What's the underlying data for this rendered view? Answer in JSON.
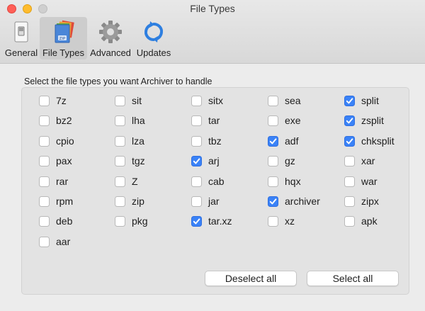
{
  "window": {
    "title": "File Types"
  },
  "toolbar": {
    "items": [
      {
        "label": "General",
        "icon": "switch-icon",
        "active": false
      },
      {
        "label": "File Types",
        "icon": "zip-archive-icon",
        "active": true
      },
      {
        "label": "Advanced",
        "icon": "gear-icon",
        "active": false
      },
      {
        "label": "Updates",
        "icon": "refresh-icon",
        "active": false
      }
    ]
  },
  "instructions": "Select the file types you want Archiver to handle",
  "file_types": {
    "columns": [
      [
        {
          "label": "7z",
          "checked": false
        },
        {
          "label": "bz2",
          "checked": false
        },
        {
          "label": "cpio",
          "checked": false
        },
        {
          "label": "pax",
          "checked": false
        },
        {
          "label": "rar",
          "checked": false
        },
        {
          "label": "rpm",
          "checked": false
        },
        {
          "label": "deb",
          "checked": false
        },
        {
          "label": "aar",
          "checked": false
        }
      ],
      [
        {
          "label": "sit",
          "checked": false
        },
        {
          "label": "lha",
          "checked": false
        },
        {
          "label": "lza",
          "checked": false
        },
        {
          "label": "tgz",
          "checked": false
        },
        {
          "label": "Z",
          "checked": false
        },
        {
          "label": "zip",
          "checked": false
        },
        {
          "label": "pkg",
          "checked": false
        }
      ],
      [
        {
          "label": "sitx",
          "checked": false
        },
        {
          "label": "tar",
          "checked": false
        },
        {
          "label": "tbz",
          "checked": false
        },
        {
          "label": "arj",
          "checked": true
        },
        {
          "label": "cab",
          "checked": false
        },
        {
          "label": "jar",
          "checked": false
        },
        {
          "label": "tar.xz",
          "checked": true
        }
      ],
      [
        {
          "label": "sea",
          "checked": false
        },
        {
          "label": "exe",
          "checked": false
        },
        {
          "label": "adf",
          "checked": true
        },
        {
          "label": "gz",
          "checked": false
        },
        {
          "label": "hqx",
          "checked": false
        },
        {
          "label": "archiver",
          "checked": true
        },
        {
          "label": "xz",
          "checked": false
        }
      ],
      [
        {
          "label": "split",
          "checked": true
        },
        {
          "label": "zsplit",
          "checked": true
        },
        {
          "label": "chksplit",
          "checked": true
        },
        {
          "label": "xar",
          "checked": false
        },
        {
          "label": "war",
          "checked": false
        },
        {
          "label": "zipx",
          "checked": false
        },
        {
          "label": "apk",
          "checked": false
        }
      ]
    ]
  },
  "buttons": {
    "deselect_all": "Deselect all",
    "select_all": "Select all"
  },
  "colors": {
    "accent": "#3a82f7",
    "close": "#ff5f57",
    "minimize": "#febc2e"
  }
}
